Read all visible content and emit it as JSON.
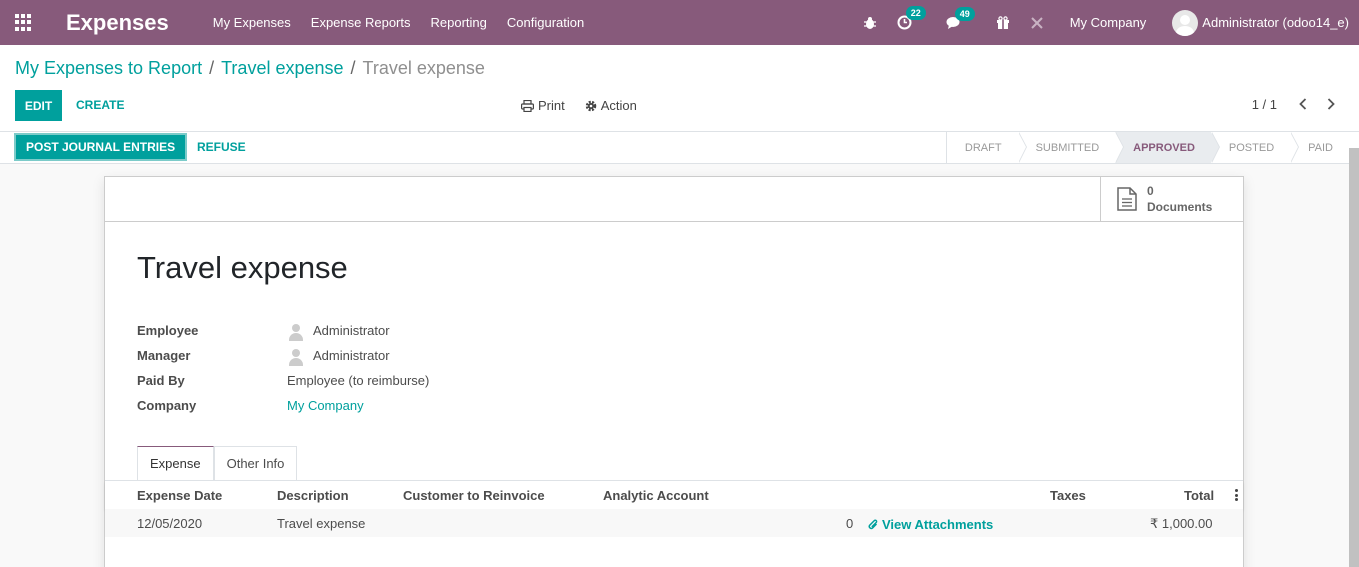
{
  "navbar": {
    "app_title": "Expenses",
    "menu": [
      "My Expenses",
      "Expense Reports",
      "Reporting",
      "Configuration"
    ],
    "activity_count": "22",
    "message_count": "49",
    "company": "My Company",
    "user": "Administrator (odoo14_e)",
    "icons": [
      "apps-icon",
      "bug-icon",
      "clock-icon",
      "chat-icon",
      "gift-icon",
      "tools-icon"
    ]
  },
  "breadcrumb": [
    "My Expenses to Report",
    "Travel expense",
    "Travel expense"
  ],
  "control_panel": {
    "edit_label": "EDIT",
    "create_label": "CREATE",
    "print_label": "Print",
    "action_label": "Action",
    "pager": "1 / 1"
  },
  "statusbar": {
    "post_label": "POST JOURNAL ENTRIES",
    "refuse_label": "REFUSE",
    "stages": [
      "DRAFT",
      "SUBMITTED",
      "APPROVED",
      "POSTED",
      "PAID"
    ],
    "active_stage": "APPROVED"
  },
  "form": {
    "documents_count": "0",
    "documents_label": "Documents",
    "title": "Travel expense",
    "fields": {
      "employee_label": "Employee",
      "employee_value": "Administrator",
      "manager_label": "Manager",
      "manager_value": "Administrator",
      "paid_by_label": "Paid By",
      "paid_by_value": "Employee (to reimburse)",
      "company_label": "Company",
      "company_value": "My Company"
    },
    "tabs": [
      "Expense",
      "Other Info"
    ]
  },
  "table": {
    "headers": [
      "Expense Date",
      "Description",
      "Customer to Reinvoice",
      "Analytic Account",
      "Taxes",
      "Total"
    ],
    "rows": [
      {
        "date": "12/05/2020",
        "description": "Travel expense",
        "attachment_count": "0",
        "attachment_label": "View Attachments",
        "total": "₹ 1,000.00"
      }
    ]
  },
  "colors": {
    "navbar": "#875a7b",
    "accent": "#00a09d"
  }
}
